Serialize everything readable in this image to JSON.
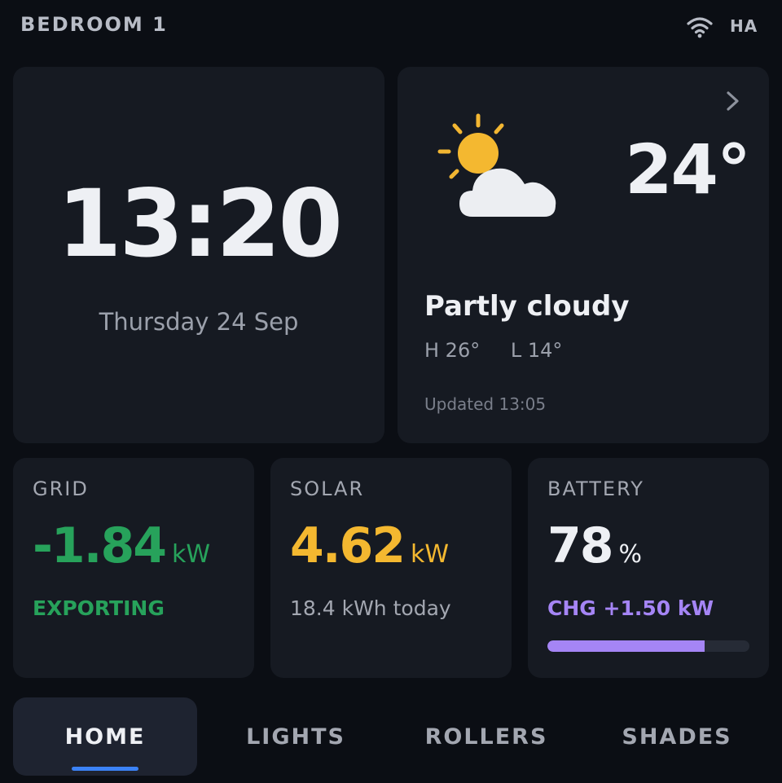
{
  "header": {
    "room_title": "BEDROOM 1",
    "status_label": "HA",
    "wifi_icon": "wifi-icon"
  },
  "clock": {
    "time": "13:20",
    "date": "Thursday 24 Sep"
  },
  "weather": {
    "temperature": "24°",
    "condition": "Partly cloudy",
    "high": "H 26°",
    "low": "L 14°",
    "updated": "Updated 13:05",
    "icon": "partly-cloudy-icon",
    "more_icon": "chevron-right-icon"
  },
  "energy": {
    "grid": {
      "label": "GRID",
      "value": "-1.84",
      "unit": "kW",
      "status": "EXPORTING",
      "color": "#27a25b"
    },
    "solar": {
      "label": "SOLAR",
      "value": "4.62",
      "unit": "kW",
      "today": "18.4 kWh today",
      "color": "#f4b830"
    },
    "battery": {
      "label": "BATTERY",
      "value": "78",
      "unit": "%",
      "status": "CHG +1.50 kW",
      "level_percent": 78,
      "color": "#a585f5"
    }
  },
  "nav": {
    "tabs": [
      {
        "label": "HOME",
        "active": true
      },
      {
        "label": "LIGHTS",
        "active": false
      },
      {
        "label": "ROLLERS",
        "active": false
      },
      {
        "label": "SHADES",
        "active": false
      }
    ],
    "active_indicator_color": "#3b82f6"
  }
}
